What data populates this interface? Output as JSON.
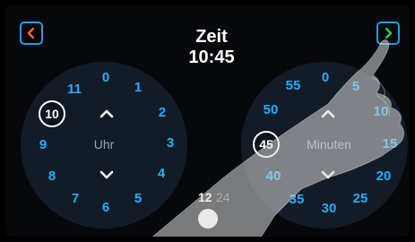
{
  "header": {
    "title": "Zeit",
    "time": "10:45",
    "prev_icon": "chevron-left-icon",
    "next_icon": "chevron-right-icon"
  },
  "hour_dial": {
    "label": "Uhr",
    "selected": "10",
    "numbers": [
      "0",
      "1",
      "2",
      "3",
      "4",
      "5",
      "6",
      "7",
      "8",
      "9",
      "11"
    ]
  },
  "minute_dial": {
    "label": "Minuten",
    "selected": "45",
    "numbers": [
      "55",
      "0",
      "5",
      "50",
      "10",
      "15",
      "40",
      "20",
      "35",
      "30",
      "25"
    ]
  },
  "format": {
    "option_12": "12",
    "option_24": "24",
    "active": "12"
  },
  "colors": {
    "accent": "#1ea0e6",
    "nav_prev": "#f06a3c",
    "nav_next": "#34c759",
    "dial_bg": "#121b26"
  }
}
